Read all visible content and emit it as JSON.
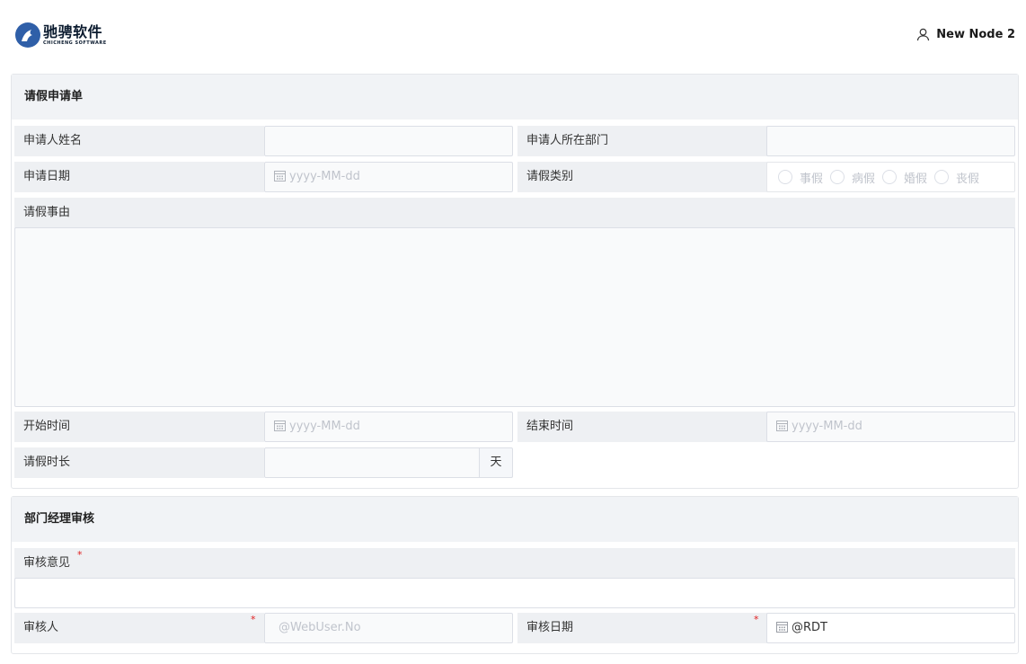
{
  "brand": {
    "name_cn": "驰骋软件",
    "name_en": "CHICHENG SOFTWARE"
  },
  "user": {
    "icon": "user-icon",
    "name": "New Node 2"
  },
  "leave_form": {
    "title": "请假申请单",
    "applicant_name_label": "申请人姓名",
    "applicant_name_value": "",
    "department_label": "申请人所在部门",
    "department_value": "",
    "apply_date_label": "申请日期",
    "apply_date_placeholder": "yyyy-MM-dd",
    "leave_type_label": "请假类别",
    "leave_types": [
      "事假",
      "病假",
      "婚假",
      "丧假"
    ],
    "reason_label": "请假事由",
    "reason_value": "",
    "start_time_label": "开始时间",
    "start_time_placeholder": "yyyy-MM-dd",
    "end_time_label": "结束时间",
    "end_time_placeholder": "yyyy-MM-dd",
    "duration_label": "请假时长",
    "duration_value": "",
    "duration_unit": "天"
  },
  "review": {
    "title": "部门经理审核",
    "opinion_label": "审核意见",
    "required_mark": "*",
    "opinion_value": "",
    "reviewer_label": "审核人",
    "reviewer_placeholder": "@WebUser.No",
    "review_date_label": "审核日期",
    "review_date_value": "@RDT"
  }
}
